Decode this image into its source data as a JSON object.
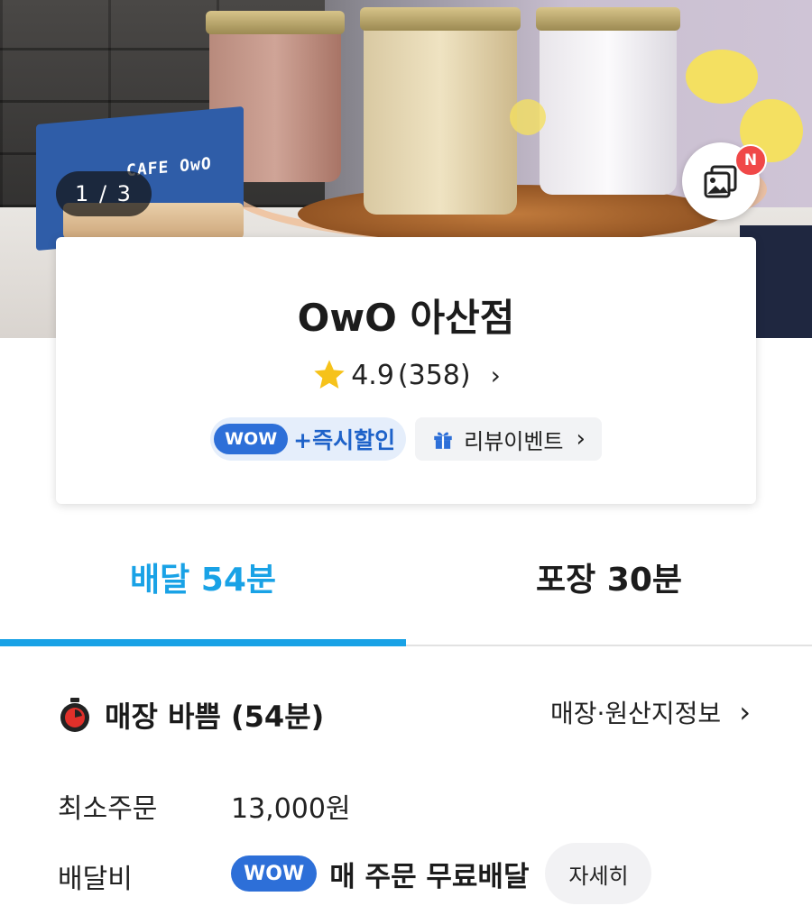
{
  "hero": {
    "image_counter": "1 / 3",
    "sign_text": "CAFE OwO",
    "gallery_badge": "N"
  },
  "store": {
    "name": "OwO 아산점",
    "rating": "4.9",
    "review_count": "(358)",
    "wow_label": "WOW",
    "wow_discount": "+즉시할인",
    "review_event": "리뷰이벤트"
  },
  "tabs": {
    "delivery_label": "배달 54분",
    "pickup_label": "포장 30분",
    "active": "delivery"
  },
  "info": {
    "busy_status": "매장 바쁨 (54분)",
    "store_info_link": "매장·원산지정보",
    "min_order_label": "최소주문",
    "min_order_value": "13,000원",
    "delivery_fee_label": "배달비",
    "delivery_fee_wow": "WOW",
    "delivery_fee_value": "매 주문 무료배달",
    "detail_button": "자세히"
  },
  "colors": {
    "accent_blue": "#19a2e6",
    "wow_blue": "#2d6fd8",
    "badge_red": "#f04848",
    "timer_red": "#e0302a"
  }
}
